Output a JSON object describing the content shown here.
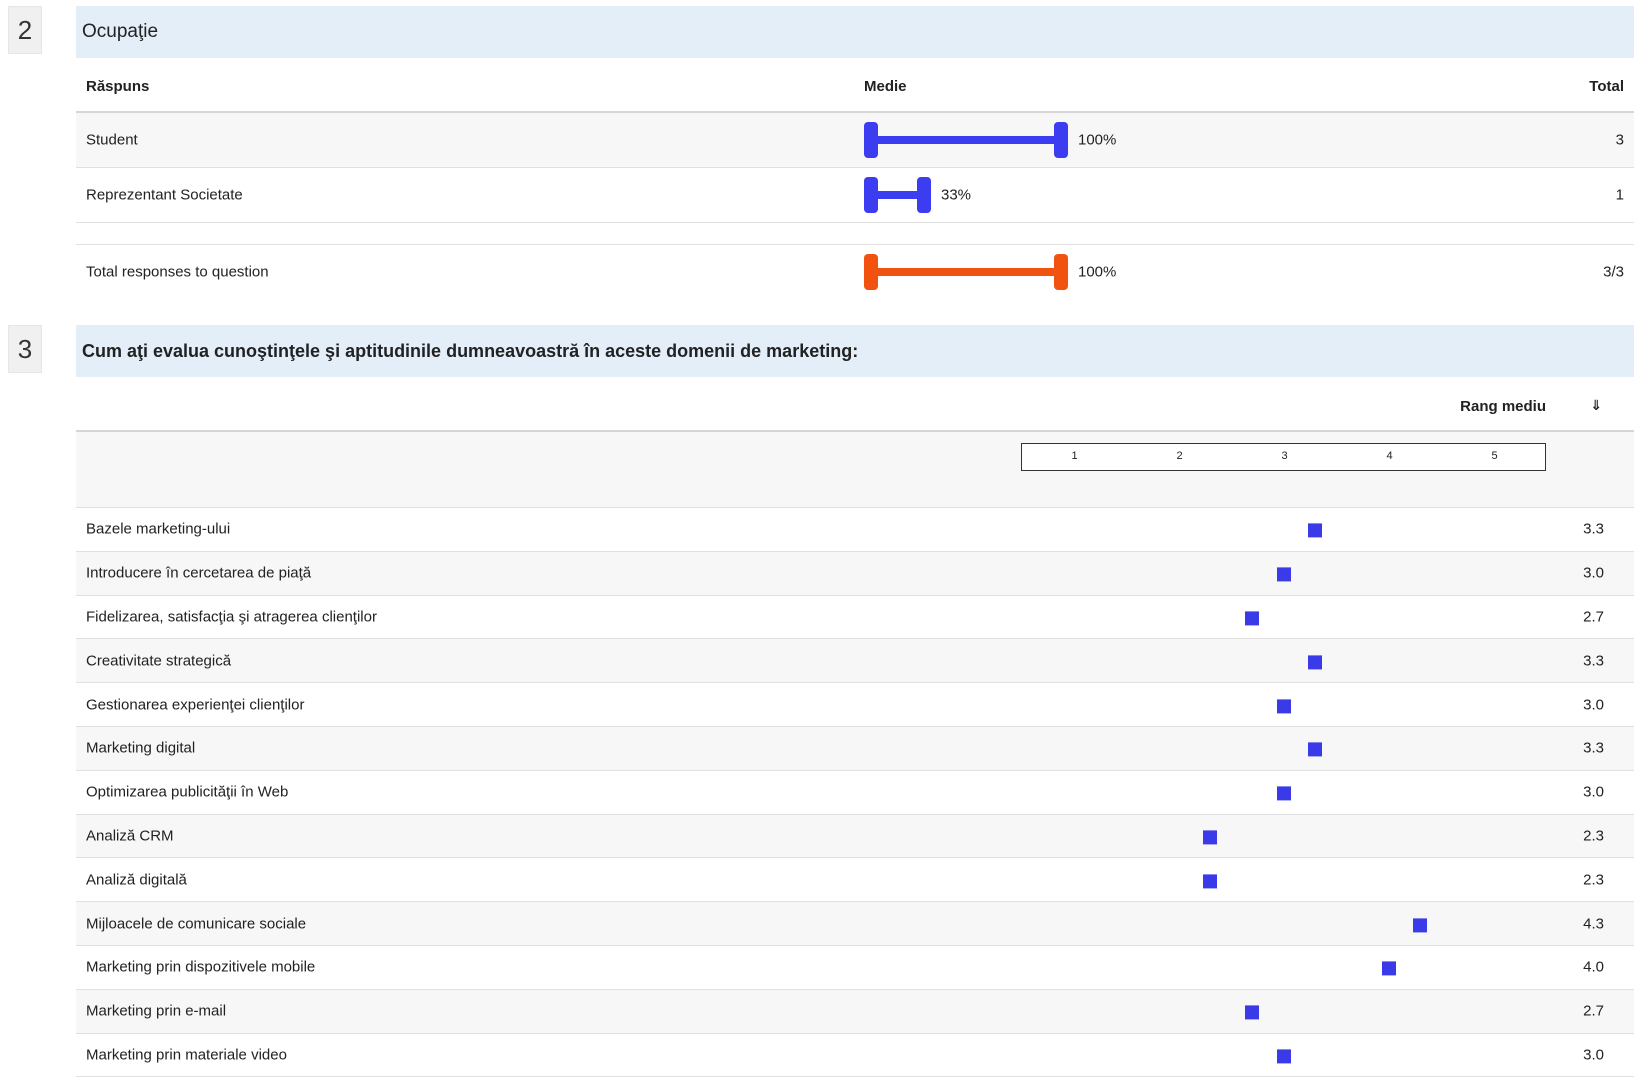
{
  "q2": {
    "number": "2",
    "title": "Ocupaţie",
    "headers": {
      "answer": "Răspuns",
      "average": "Medie",
      "total": "Total"
    },
    "rows": [
      {
        "label": "Student",
        "percent_text": "100%",
        "fill": 1.0,
        "total": "3",
        "color": "#3c3cf0"
      },
      {
        "label": "Reprezentant Societate",
        "percent_text": "33%",
        "fill": 0.33,
        "total": "1",
        "color": "#3c3cf0"
      }
    ],
    "summary": {
      "label": "Total responses to question",
      "percent_text": "100%",
      "fill": 1.0,
      "total": "3/3",
      "color": "#f2520f"
    }
  },
  "q3": {
    "number": "3",
    "title": "Cum aţi evalua cunoştinţele şi aptitudinile dumneavoastră în aceste domenii de marketing:",
    "headers": {
      "rank": "Rang mediu",
      "sort_icon": "⇓"
    },
    "scale": [
      "1",
      "2",
      "3",
      "4",
      "5"
    ],
    "marker_color": "#3a3ae8",
    "rows": [
      {
        "label": "Bazele marketing-ului",
        "value": 3.3,
        "value_text": "3.3"
      },
      {
        "label": "Introducere în cercetarea de piaţă",
        "value": 3.0,
        "value_text": "3.0"
      },
      {
        "label": "Fidelizarea, satisfacţia şi atragerea clienţilor",
        "value": 2.7,
        "value_text": "2.7"
      },
      {
        "label": "Creativitate strategică",
        "value": 3.3,
        "value_text": "3.3"
      },
      {
        "label": "Gestionarea experienţei clienţilor",
        "value": 3.0,
        "value_text": "3.0"
      },
      {
        "label": "Marketing digital",
        "value": 3.3,
        "value_text": "3.3"
      },
      {
        "label": "Optimizarea publicităţii în Web",
        "value": 3.0,
        "value_text": "3.0"
      },
      {
        "label": "Analiză CRM",
        "value": 2.3,
        "value_text": "2.3"
      },
      {
        "label": "Analiză digitală",
        "value": 2.3,
        "value_text": "2.3"
      },
      {
        "label": "Mijloacele de comunicare sociale",
        "value": 4.3,
        "value_text": "4.3"
      },
      {
        "label": "Marketing prin dispozitivele mobile",
        "value": 4.0,
        "value_text": "4.0"
      },
      {
        "label": "Marketing prin e-mail",
        "value": 2.7,
        "value_text": "2.7"
      },
      {
        "label": "Marketing prin materiale video",
        "value": 3.0,
        "value_text": "3.0"
      }
    ]
  }
}
